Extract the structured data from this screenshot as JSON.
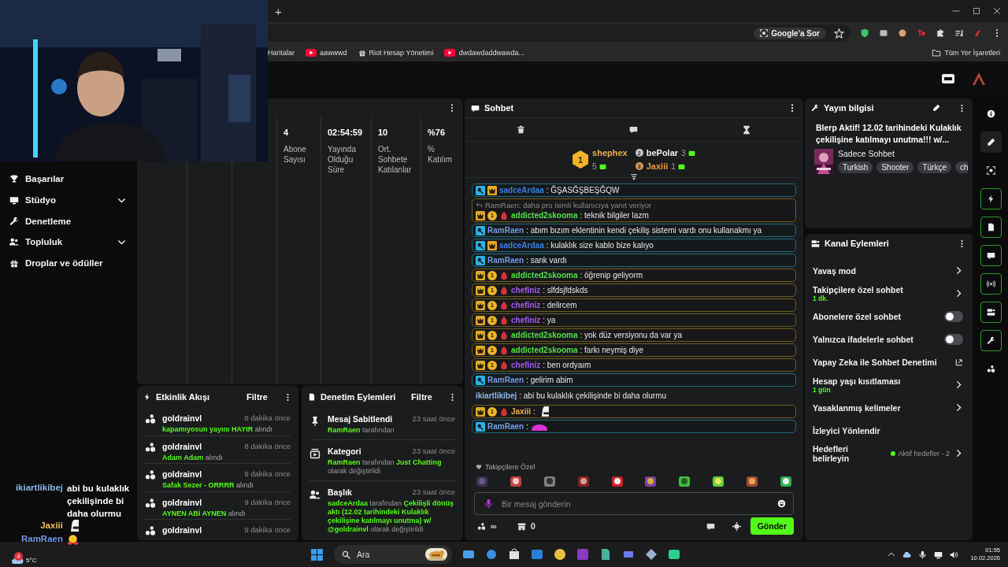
{
  "browser": {
    "new_tab": "+",
    "ask_google": "Google'a Sor",
    "bookmarks": [
      "Haritalar",
      "aawwwd",
      "Riot Hesap Yönetimi",
      "dwdawdaddwawda..."
    ],
    "all_bookmarks": "Tüm Yer İşaretleri"
  },
  "sidebar": {
    "items": [
      {
        "label": "Başarılar",
        "expandable": false
      },
      {
        "label": "Stüdyo",
        "expandable": true
      },
      {
        "label": "Denetleme",
        "expandable": false
      },
      {
        "label": "Topluluk",
        "expandable": true
      },
      {
        "label": "Droplar ve ödüller",
        "expandable": false
      }
    ]
  },
  "stats": [
    {
      "value": "4",
      "label": "Abone Sayısı"
    },
    {
      "value": "02:54:59",
      "label": "Yayında Olduğu Süre"
    },
    {
      "value": "10",
      "label": "Ort. Sohbete Katılanlar"
    },
    {
      "value": "%76",
      "label": "% Katılım"
    }
  ],
  "chat": {
    "title": "Sohbet",
    "leaders": [
      {
        "rank": "1",
        "name": "shephex",
        "count": "5",
        "color": "#e8b24a"
      },
      {
        "rank": "2",
        "name": "bePolar",
        "count": "3",
        "color": "#f2f2f2"
      },
      {
        "rank": "3",
        "name": "Jaxiii",
        "count": "1",
        "color": "#e89a3c"
      }
    ],
    "messages": [
      {
        "kind": "mod",
        "mod_badge": true,
        "crown_badge": true,
        "drop_badge": false,
        "user": "sadceArdaa",
        "color": "#3b7de8",
        "text": ": ĞŞASĞŞBEŞĞQW"
      },
      {
        "kind": "sub",
        "mod_badge": false,
        "crown_badge": true,
        "sub_months": "1",
        "drop_badge": true,
        "user": "addicted2skooma",
        "color": "#52e04a",
        "text": ": teknik bilgiler lazm",
        "reply": "RamRaen: daha pro isimli kullanıcıya yanıt veriyor"
      },
      {
        "kind": "mod",
        "mod_badge": true,
        "crown_badge": false,
        "drop_badge": false,
        "user": "RamRaen",
        "color": "#6f9ee8",
        "text": ": abım bızım eklentinin kendi çekiliş sistemi vardı onu kullanakmı ya"
      },
      {
        "kind": "mod",
        "mod_badge": true,
        "crown_badge": true,
        "drop_badge": false,
        "user": "sadceArdaa",
        "color": "#3b7de8",
        "text": ": kulaklık size kablo bize kalıyo"
      },
      {
        "kind": "mod",
        "mod_badge": true,
        "crown_badge": false,
        "drop_badge": false,
        "user": "RamRaen",
        "color": "#6f9ee8",
        "text": ": sank vardı"
      },
      {
        "kind": "sub",
        "mod_badge": false,
        "crown_badge": true,
        "sub_months": "1",
        "drop_badge": true,
        "user": "addicted2skooma",
        "color": "#52e04a",
        "text": ": öğrenip geliyorm"
      },
      {
        "kind": "sub",
        "mod_badge": false,
        "crown_badge": true,
        "sub_months": "1",
        "drop_badge": true,
        "user": "chefiniz",
        "color": "#a55cf0",
        "text": ": slfdsjfdskds"
      },
      {
        "kind": "sub",
        "mod_badge": false,
        "crown_badge": true,
        "sub_months": "1",
        "drop_badge": true,
        "user": "chefiniz",
        "color": "#a55cf0",
        "text": ": delircem"
      },
      {
        "kind": "sub",
        "mod_badge": false,
        "crown_badge": true,
        "sub_months": "1",
        "drop_badge": true,
        "user": "chefiniz",
        "color": "#a55cf0",
        "text": ": ya"
      },
      {
        "kind": "sub",
        "mod_badge": false,
        "crown_badge": true,
        "sub_months": "1",
        "drop_badge": true,
        "user": "addicted2skooma",
        "color": "#52e04a",
        "text": ": yok düz versiyonu da var ya"
      },
      {
        "kind": "sub",
        "mod_badge": false,
        "crown_badge": true,
        "sub_months": "1",
        "drop_badge": true,
        "user": "addicted2skooma",
        "color": "#52e04a",
        "text": ": farkı neymiş diye"
      },
      {
        "kind": "sub",
        "mod_badge": false,
        "crown_badge": true,
        "sub_months": "1",
        "drop_badge": true,
        "user": "chefiniz",
        "color": "#a55cf0",
        "text": ": ben ordyaım"
      },
      {
        "kind": "mod",
        "mod_badge": true,
        "crown_badge": false,
        "drop_badge": false,
        "user": "RamRaen",
        "color": "#6f9ee8",
        "text": ": gelirim abim"
      },
      {
        "kind": "plain",
        "mod_badge": false,
        "crown_badge": false,
        "drop_badge": false,
        "user": "ikiartlikibej",
        "color": "#8fb8e8",
        "text": ": abi bu kulaklık çekilişinde bi daha olurmu"
      },
      {
        "kind": "sub",
        "mod_badge": false,
        "crown_badge": true,
        "sub_months": "1",
        "drop_badge": true,
        "user": "Jaxiii",
        "color": "#e8b050",
        "text": ":",
        "emote": true
      },
      {
        "kind": "mod",
        "mod_badge": true,
        "crown_badge": false,
        "drop_badge": false,
        "user": "RamRaen",
        "color": "#6f9ee8",
        "text": ":",
        "emote": true
      }
    ],
    "follower_notice": "Takipçilere Özel",
    "placeholder": "Bir mesaj gönderin",
    "infinity": "∞",
    "points": "0",
    "send": "Gönder"
  },
  "events": {
    "title": "Etkinlik Akışı",
    "filter": "Filtre",
    "items": [
      {
        "user": "goldrainvl",
        "time": "8 dakika önce",
        "reward": "kapamıyosun yayını HAYIR",
        "suffix": "alındı"
      },
      {
        "user": "goldrainvl",
        "time": "8 dakika önce",
        "reward": "Adam Adam",
        "suffix": "alındı"
      },
      {
        "user": "goldrainvl",
        "time": "9 dakika önce",
        "reward": "Safak Sezer - ORRRR",
        "suffix": "alındı"
      },
      {
        "user": "goldrainvl",
        "time": "9 dakika önce",
        "reward": "AYNEN ABİ AYNEN",
        "suffix": "alındı"
      },
      {
        "user": "goldrainvl",
        "time": "9 dakika önce"
      }
    ]
  },
  "mod_log": {
    "title": "Denetim Eylemleri",
    "filter": "Filtre",
    "items": [
      {
        "title": "Mesaj Sabitlendi",
        "time": "23 saat önce",
        "detail": [
          {
            "text": "RamRaen",
            "highlight": true
          },
          {
            "text": " tarafından",
            "highlight": false
          }
        ]
      },
      {
        "title": "Kategori",
        "time": "23 saat önce",
        "detail": [
          {
            "text": "RamRaen",
            "highlight": true
          },
          {
            "text": " tarafından ",
            "highlight": false
          },
          {
            "text": "Just Chatting",
            "highlight": true
          },
          {
            "text": " olarak değiştirildi",
            "highlight": false
          }
        ]
      },
      {
        "title": "Başlık",
        "time": "23 saat önce",
        "detail": [
          {
            "text": "sadceArdaa",
            "highlight": true
          },
          {
            "text": " tarafından ",
            "highlight": false
          },
          {
            "text": "Çekilişli dönüş aktı (12.02 tarihindeki Kulaklık çekilişine katılmayı unutma) w/ @goldrainvl",
            "highlight": true
          },
          {
            "text": " olarak değiştirildi",
            "highlight": false
          }
        ]
      }
    ]
  },
  "stream_info": {
    "title": "Yayın bilgisi",
    "stream_title": "Blerp Aktif! 12.02 tarihindeki Kulaklık çekilişine katılmayı unutma!!! w/...",
    "category": "Sadece Sohbet",
    "tags": [
      "Turkish",
      "Shooter",
      "Türkçe",
      "ch"
    ]
  },
  "channel_actions": {
    "title": "Kanal Eylemleri",
    "items": [
      {
        "kind": "link",
        "label": "Yavaş mod"
      },
      {
        "kind": "link",
        "label": "Takipçilere özel sohbet",
        "value": "1 dk."
      },
      {
        "kind": "toggle",
        "label": "Abonelere özel sohbet",
        "on": false
      },
      {
        "kind": "toggle",
        "label": "Yalnızca ifadelerle sohbet",
        "on": false
      },
      {
        "kind": "external",
        "label": "Yapay Zeka ile Sohbet Denetimi"
      },
      {
        "kind": "link",
        "label": "Hesap yaşı kısıtlaması",
        "value": "1 gün"
      },
      {
        "kind": "link",
        "label": "Yasaklanmış kelimeler"
      },
      {
        "kind": "plain",
        "label": "İzleyici Yönlendir"
      },
      {
        "kind": "link",
        "label": "Hedefleri belirleyin",
        "status": "Aktif hedefler - 2"
      }
    ]
  },
  "taskbar": {
    "weather": "5°C",
    "weather_badge": "4",
    "search": "Ara",
    "time": "01:55",
    "date": "10.02.2026"
  },
  "overlay_chat": [
    {
      "user": "ikiartlikibej",
      "color": "#8fb8e8",
      "text": "abi bu kulaklık çekilişinde bi daha olurmu"
    },
    {
      "user": "Jaxiii",
      "color": "#f0c060",
      "emote": true
    },
    {
      "user": "RamRaen",
      "color": "#6f9ee8",
      "emote": true
    }
  ]
}
